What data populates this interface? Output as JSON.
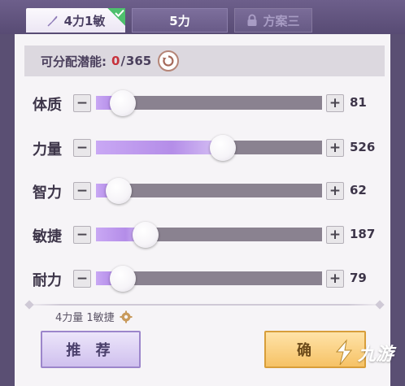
{
  "tabs": [
    {
      "label": "4力1敏",
      "active": true,
      "checked": true
    },
    {
      "label": "5力",
      "active": false
    },
    {
      "label": "方案三",
      "active": false,
      "locked": true
    }
  ],
  "potential": {
    "label": "可分配潜能:",
    "current": "0",
    "separator": "/",
    "total": "365"
  },
  "stats": [
    {
      "label": "体质",
      "value": "81",
      "level": 0.12
    },
    {
      "label": "力量",
      "value": "526",
      "level": 0.56
    },
    {
      "label": "智力",
      "value": "62",
      "level": 0.1
    },
    {
      "label": "敏捷",
      "value": "187",
      "level": 0.22
    },
    {
      "label": "耐力",
      "value": "79",
      "level": 0.12
    }
  ],
  "summary": "4力量 1敏捷",
  "buttons": {
    "recommend": "推 荐",
    "confirm": "确"
  },
  "watermark": "九游",
  "colors": {
    "accent_purple": "#b48de8",
    "confirm_gold": "#f6c266",
    "potential_zero": "#c7313b",
    "check_green": "#4ec06d"
  }
}
